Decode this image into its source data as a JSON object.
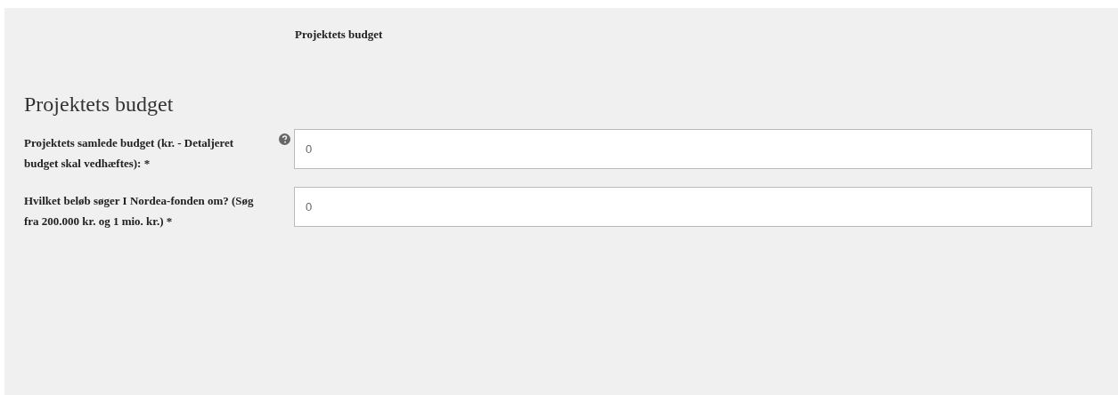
{
  "page_label": "Projektets budget",
  "section": {
    "title": "Projektets budget",
    "fields": [
      {
        "label": "Projektets samlede budget (kr. - Detaljeret budget skal vedhæftes): *",
        "help": true,
        "value": "0"
      },
      {
        "label": "Hvilket beløb søger I Nordea-fonden om? (Søg fra 200.000 kr. og 1 mio. kr.) *",
        "help": false,
        "value": "0"
      }
    ]
  }
}
